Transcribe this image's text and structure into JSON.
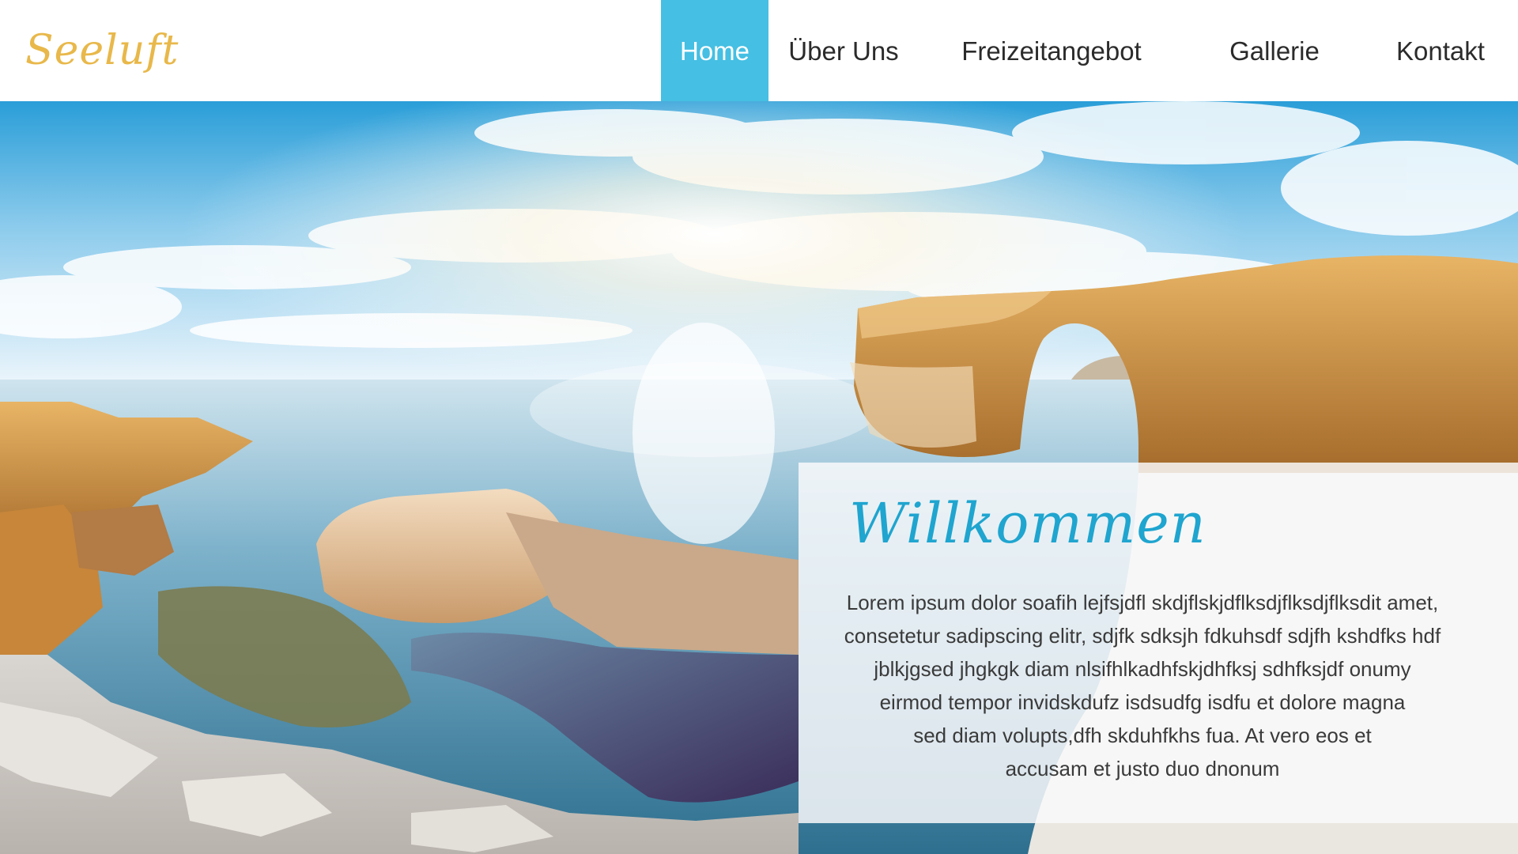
{
  "brand": {
    "logo_text": "Seeluft",
    "logo_color": "#e8b84a"
  },
  "nav": {
    "accent": "#45bfe3",
    "items": [
      {
        "label": "Home",
        "active": true
      },
      {
        "label": "Über Uns",
        "active": false
      },
      {
        "label": "Freizeitangebot",
        "active": false
      },
      {
        "label": "Gallerie",
        "active": false
      },
      {
        "label": "Kontakt",
        "active": false
      }
    ]
  },
  "hero": {
    "image_alt": ""
  },
  "welcome": {
    "title": "Willkommen",
    "title_color": "#1fa5cf",
    "lines": [
      "Lorem ipsum dolor soafih lejfsjdfl skdjflskjdflksdjflksdjflksdit amet,",
      "consetetur sadipscing elitr, sdjfk sdksjh fdkuhsdf sdjfh kshdfks hdf",
      "jblkjgsed jhgkgk diam nlsifhlkadhfskjdhfksj sdhfksjdf onumy",
      "eirmod tempor invidskdufz isdsudfg isdfu et dolore magna",
      "sed diam volupts,dfh skduhfkhs fua. At vero eos et",
      "accusam et justo duo dnonum"
    ]
  }
}
